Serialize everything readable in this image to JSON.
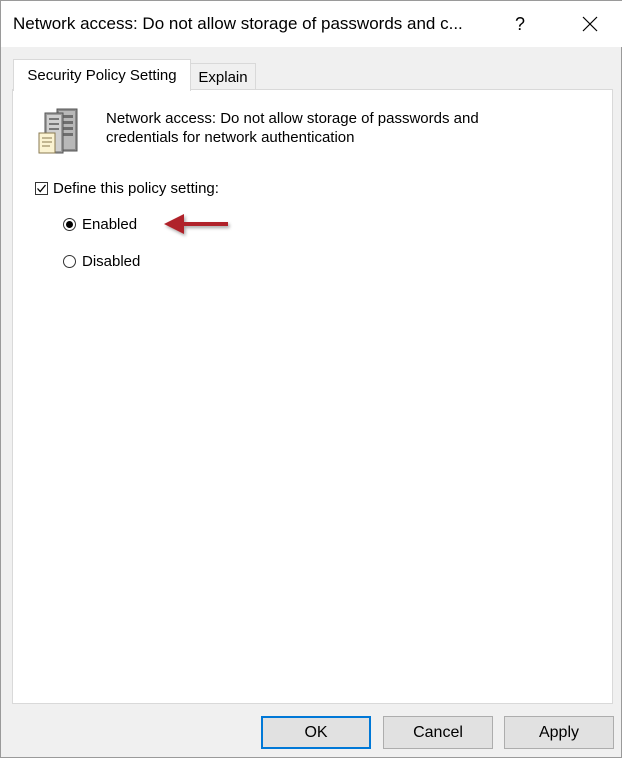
{
  "window": {
    "title": "Network access: Do not allow storage of passwords and c...",
    "help_label": "?",
    "close_icon": "close-icon"
  },
  "tabs": [
    {
      "label": "Security Policy Setting",
      "active": true
    },
    {
      "label": "Explain",
      "active": false
    }
  ],
  "policy": {
    "icon": "server-policy-icon",
    "description": "Network access: Do not allow storage of passwords and credentials for network authentication"
  },
  "define": {
    "label": "Define this policy setting:",
    "checked": true
  },
  "options": [
    {
      "label": "Enabled",
      "selected": true
    },
    {
      "label": "Disabled",
      "selected": false
    }
  ],
  "annotation": {
    "arrow_color": "#b0202a",
    "icon": "red-arrow-icon"
  },
  "buttons": {
    "ok": "OK",
    "cancel": "Cancel",
    "apply": "Apply"
  },
  "colors": {
    "focus_border": "#0078d7",
    "panel_bg": "#ffffff",
    "window_bg": "#f0f0f0"
  }
}
